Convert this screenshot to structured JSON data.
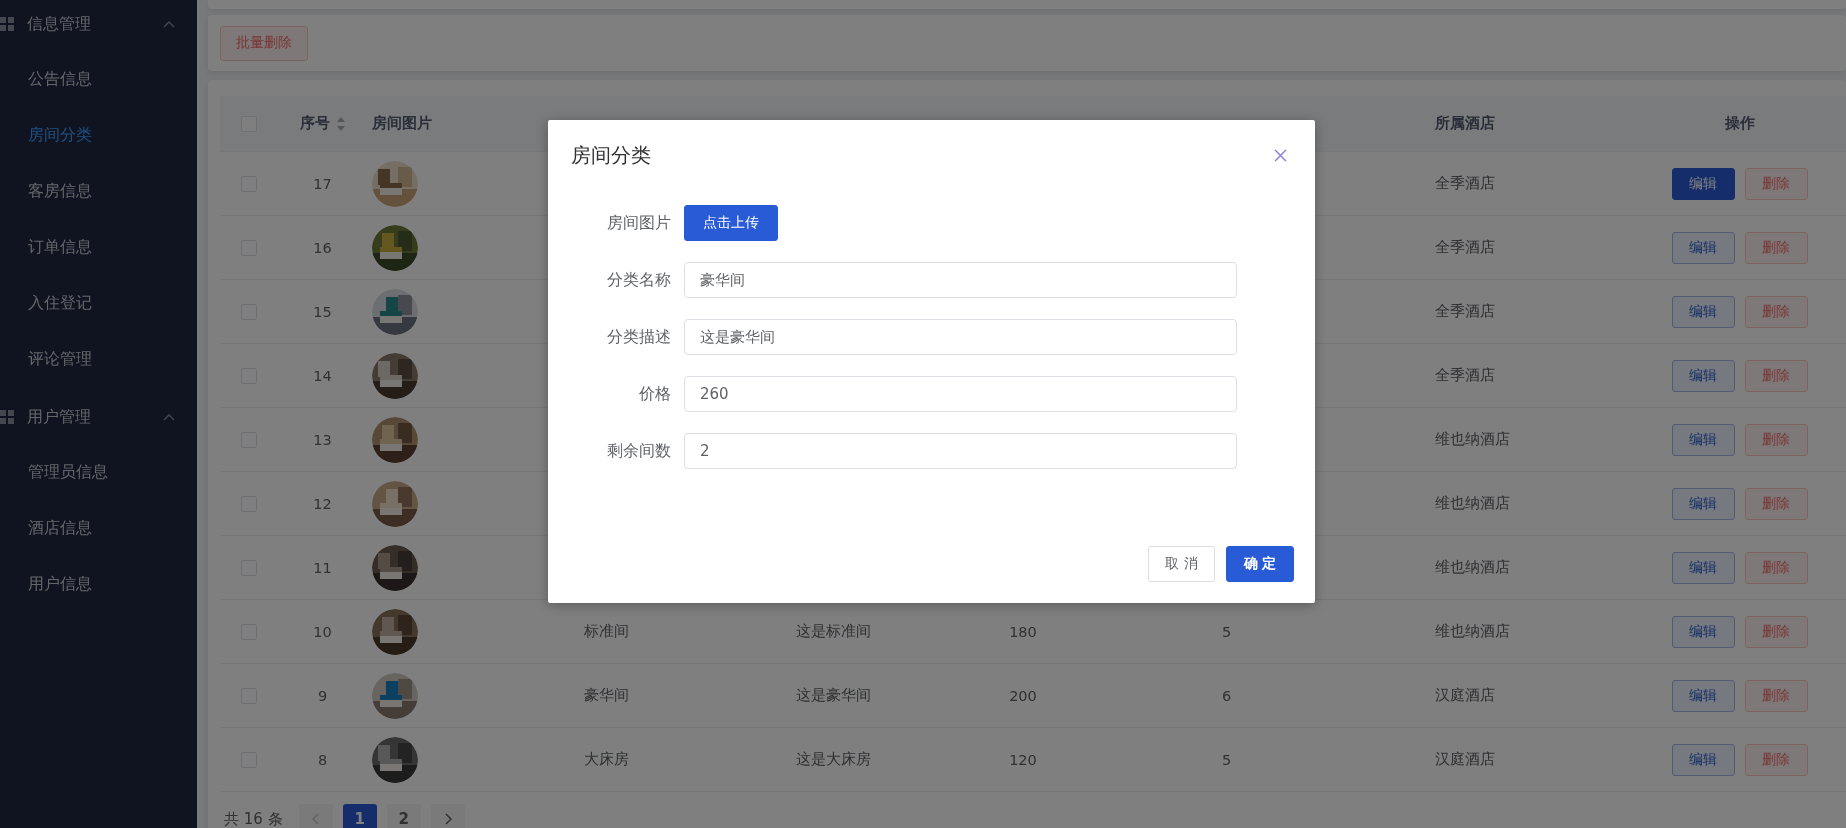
{
  "sidebar": {
    "groups": [
      {
        "title": "信息管理",
        "expanded": true,
        "items": [
          {
            "label": "公告信息",
            "selected": false
          },
          {
            "label": "房间分类",
            "selected": true
          },
          {
            "label": "客房信息",
            "selected": false
          },
          {
            "label": "订单信息",
            "selected": false
          },
          {
            "label": "入住登记",
            "selected": false
          },
          {
            "label": "评论管理",
            "selected": false
          }
        ]
      },
      {
        "title": "用户管理",
        "expanded": true,
        "items": [
          {
            "label": "管理员信息",
            "selected": false
          },
          {
            "label": "酒店信息",
            "selected": false
          },
          {
            "label": "用户信息",
            "selected": false
          }
        ]
      }
    ]
  },
  "toolbar": {
    "batch_delete": "批量删除"
  },
  "table": {
    "select_all_checked": false,
    "columns": [
      "序号",
      "房间图片",
      "所属酒店",
      "操作"
    ],
    "rows": [
      {
        "checked": false,
        "no": "17",
        "hotel": "全季酒店",
        "edit": "编辑",
        "delete": "删除",
        "edit_focused": true
      },
      {
        "checked": false,
        "no": "16",
        "hotel": "全季酒店",
        "edit": "编辑",
        "delete": "删除",
        "edit_focused": false
      },
      {
        "checked": false,
        "no": "15",
        "hotel": "全季酒店",
        "edit": "编辑",
        "delete": "删除",
        "edit_focused": false
      },
      {
        "checked": false,
        "no": "14",
        "hotel": "全季酒店",
        "edit": "编辑",
        "delete": "删除",
        "edit_focused": false
      },
      {
        "checked": false,
        "no": "13",
        "hotel": "维也纳酒店",
        "edit": "编辑",
        "delete": "删除",
        "edit_focused": false
      },
      {
        "checked": false,
        "no": "12",
        "hotel": "维也纳酒店",
        "edit": "编辑",
        "delete": "删除",
        "edit_focused": false
      },
      {
        "checked": false,
        "no": "11",
        "hotel": "维也纳酒店",
        "edit": "编辑",
        "delete": "删除",
        "edit_focused": false
      },
      {
        "checked": false,
        "no": "10",
        "name": "标准间",
        "desc": "这是标准间",
        "price": "180",
        "remain": "5",
        "hotel": "维也纳酒店",
        "edit": "编辑",
        "delete": "删除",
        "edit_focused": false
      },
      {
        "checked": false,
        "no": "9",
        "name": "豪华间",
        "desc": "这是豪华间",
        "price": "200",
        "remain": "6",
        "hotel": "汉庭酒店",
        "edit": "编辑",
        "delete": "删除",
        "edit_focused": false
      },
      {
        "checked": false,
        "no": "8",
        "name": "大床房",
        "desc": "这是大床房",
        "price": "120",
        "remain": "5",
        "hotel": "汉庭酒店",
        "edit": "编辑",
        "delete": "删除",
        "edit_focused": false
      }
    ]
  },
  "pagination": {
    "total": "共 16 条",
    "pages": [
      {
        "label": "1",
        "selected": true
      },
      {
        "label": "2",
        "selected": false
      }
    ]
  },
  "dialog": {
    "title": "房间分类",
    "fields": [
      {
        "kind": "upload",
        "label": "房间图片",
        "button": "点击上传"
      },
      {
        "kind": "text",
        "label": "分类名称",
        "value": "豪华间"
      },
      {
        "kind": "text",
        "label": "分类描述",
        "value": "这是豪华间"
      },
      {
        "kind": "text",
        "label": "价格",
        "value": "260"
      },
      {
        "kind": "text",
        "label": "剩余间数",
        "value": "2"
      }
    ],
    "cancel": "取 消",
    "confirm": "确 定"
  }
}
